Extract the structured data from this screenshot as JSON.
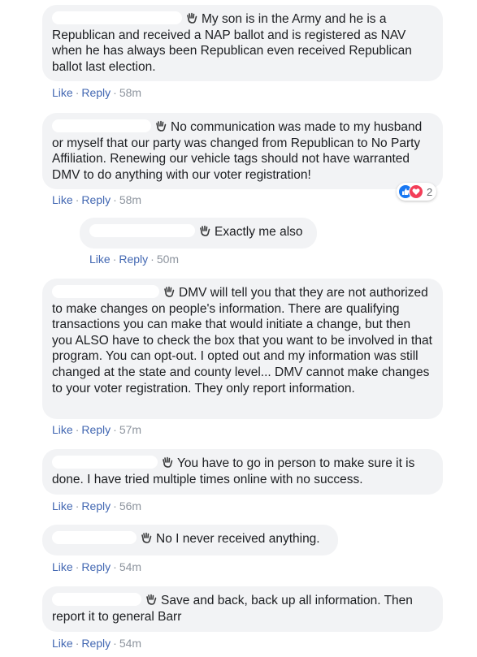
{
  "actions": {
    "like": "Like",
    "reply": "Reply",
    "sep": "·"
  },
  "colors": {
    "link": "#4267b2",
    "bubble": "#f2f3f5",
    "meta": "#8d949e",
    "like_reaction": "#1877f2",
    "love_reaction": "#f33e58"
  },
  "icons": {
    "wave": "wave-hand-icon",
    "like": "thumbs-up-icon",
    "love": "heart-icon"
  },
  "comments": [
    {
      "text": "My son is in the Army and he is a Republican and received a NAP ballot and is registered as NAV when he has always been Republican even received Republican ballot last election.",
      "time": "58m"
    },
    {
      "text": "No communication was made to my husband or myself that our party was changed from Republican to No Party Affiliation. Renewing our vehicle tags should not have warranted DMV to do anything with our voter registration!",
      "time": "58m",
      "reaction_count": "2"
    },
    {
      "text": "Exactly me also",
      "time": "50m"
    },
    {
      "text": "DMV will tell you that they are not authorized to make changes on people's information. There are qualifying transactions you can make that would initiate a change, but then you ALSO have to check the box that you want to be involved in that program. You can opt-out. I opted out and my information was still changed at the state and county level... DMV cannot make changes to your voter registration. They only report information.",
      "time": "57m"
    },
    {
      "text": "You have to go in person to make sure it is done. I have tried multiple times online with no success.",
      "time": "56m"
    },
    {
      "text": "No I never received anything.",
      "time": "54m"
    },
    {
      "text": "Save and back, back up all information. Then report it to general Barr",
      "time": "54m"
    }
  ]
}
